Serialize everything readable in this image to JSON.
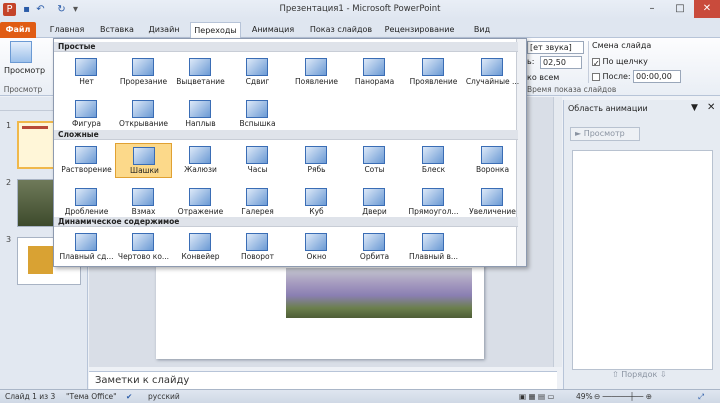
{
  "window": {
    "title": "Презентация1 - Microsoft PowerPoint"
  },
  "tabs": [
    {
      "label": "Файл",
      "k": "file"
    },
    {
      "label": "Главная"
    },
    {
      "label": "Вставка"
    },
    {
      "label": "Дизайн"
    },
    {
      "label": "Переходы",
      "k": "active"
    },
    {
      "label": "Анимация"
    },
    {
      "label": "Показ слайдов"
    },
    {
      "label": "Рецензирование"
    },
    {
      "label": "Вид"
    }
  ],
  "ribbon": {
    "preview_label": "Просмотр",
    "preview_group": "Просмотр",
    "sound_value": "[ет звука]",
    "duration_value": "02,50",
    "apply_all": "ко всем",
    "timing_group": "Время показа слайдов",
    "change_slide": "Смена слайда",
    "on_click": "По щелчку",
    "after": "После:",
    "after_value": "00:00,00"
  },
  "gallery": {
    "sections": [
      {
        "title": "Простые",
        "items": [
          "Нет",
          "Прорезание",
          "Выцветание",
          "Сдвиг",
          "Появление",
          "Панорама",
          "Проявление",
          "Случайные ...",
          "Фигура",
          "Открывание",
          "Наплыв",
          "Вспышка"
        ]
      },
      {
        "title": "Сложные",
        "items": [
          "Растворение",
          "Шашки",
          "Жалюзи",
          "Часы",
          "Рябь",
          "Соты",
          "Блеск",
          "Воронка",
          "Дробление",
          "Взмах",
          "Отражение",
          "Галерея",
          "Куб",
          "Двери",
          "Прямоугол...",
          "Увеличение"
        ]
      },
      {
        "title": "Динамическое содержимое",
        "items": [
          "Плавный сд...",
          "Чертово ко...",
          "Конвейер",
          "Поворот",
          "Окно",
          "Орбита",
          "Плавный в..."
        ]
      }
    ],
    "selected": "Шашки"
  },
  "slides": [
    "1",
    "2",
    "3"
  ],
  "notes": "Заметки к слайду",
  "anim_pane": {
    "title": "Область анимации",
    "preview": "Просмотр",
    "order": "Порядок"
  },
  "status": {
    "slide": "Слайд 1 из 3",
    "theme": "\"Тема Office\"",
    "lang": "русский",
    "zoom": "49%"
  },
  "colors": {
    "accent": "#2a5ba8",
    "file_tab": "#e05c14",
    "selected": "#fcd98a"
  }
}
